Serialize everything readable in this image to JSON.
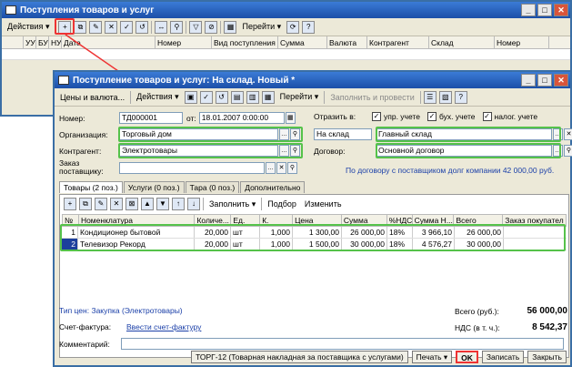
{
  "back_window": {
    "title": "Поступления товаров и услуг",
    "toolbar": {
      "actions": "Действия",
      "goto": "Перейти",
      "help": "?"
    },
    "columns": [
      "УУ",
      "БУ",
      "НУ",
      "Дата",
      "Номер",
      "Вид поступления",
      "Сумма",
      "Валюта",
      "Контрагент",
      "Склад",
      "Номер"
    ]
  },
  "front_window": {
    "title": "Поступление товаров и услуг: На склад. Новый *",
    "toolbar": {
      "prices": "Цены и валюта...",
      "actions": "Действия",
      "goto": "Перейти",
      "fill_post": "Заполнить и провести"
    },
    "number_label": "Номер:",
    "number_value": "ТД000001",
    "date_label": "от:",
    "date_value": "18.01.2007 0:00:00",
    "reflect_label": "Отразить в:",
    "reflect": [
      "упр. учете",
      "бух. учете",
      "налог. учете"
    ],
    "org_label": "Организация:",
    "org_value": "Торговый дом",
    "to_warehouse": "На склад",
    "warehouse_value": "Главный склад",
    "contractor_label": "Контрагент:",
    "contractor_value": "Электротовары",
    "contract_label": "Договор:",
    "contract_value": "Основной договор",
    "order_label_1": "Заказ",
    "order_label_2": "поставщику:",
    "debt_text": "По договору с поставщиком долг компании 42 000,00 руб.",
    "tabs": [
      "Товары (2 поз.)",
      "Услуги (0 поз.)",
      "Тара (0 поз.)",
      "Дополнительно"
    ],
    "subtoolbar": {
      "fill": "Заполнить",
      "select": "Подбор",
      "change": "Изменить"
    },
    "table_columns": [
      "№",
      "Номенклатура",
      "Количе...",
      "Ед.",
      "К.",
      "Цена",
      "Сумма",
      "%НДС",
      "Сумма Н...",
      "Всего",
      "Заказ покупател"
    ],
    "rows": [
      [
        "1",
        "Кондиционер бытовой",
        "20,000",
        "шт",
        "1,000",
        "1 300,00",
        "26 000,00",
        "18%",
        "3 966,10",
        "26 000,00",
        ""
      ],
      [
        "2",
        "Телевизор Рекорд",
        "20,000",
        "шт",
        "1,000",
        "1 500,00",
        "30 000,00",
        "18%",
        "4 576,27",
        "30 000,00",
        ""
      ]
    ],
    "price_type": "Тип цен: Закупка (Электротовары)",
    "total_label": "Всего (руб.):",
    "total_value": "56 000,00",
    "invoice_label": "Счет-фактура:",
    "invoice_link": "Ввести счет-фактуру",
    "vat_label": "НДС (в т. ч.):",
    "vat_value": "8 542,37",
    "comment_label": "Комментарий:",
    "bottom": {
      "torg": "ТОРГ-12 (Товарная накладная за поставщика с услугами)",
      "print": "Печать",
      "ok": "OK",
      "save": "Записать",
      "close": "Закрыть"
    }
  }
}
